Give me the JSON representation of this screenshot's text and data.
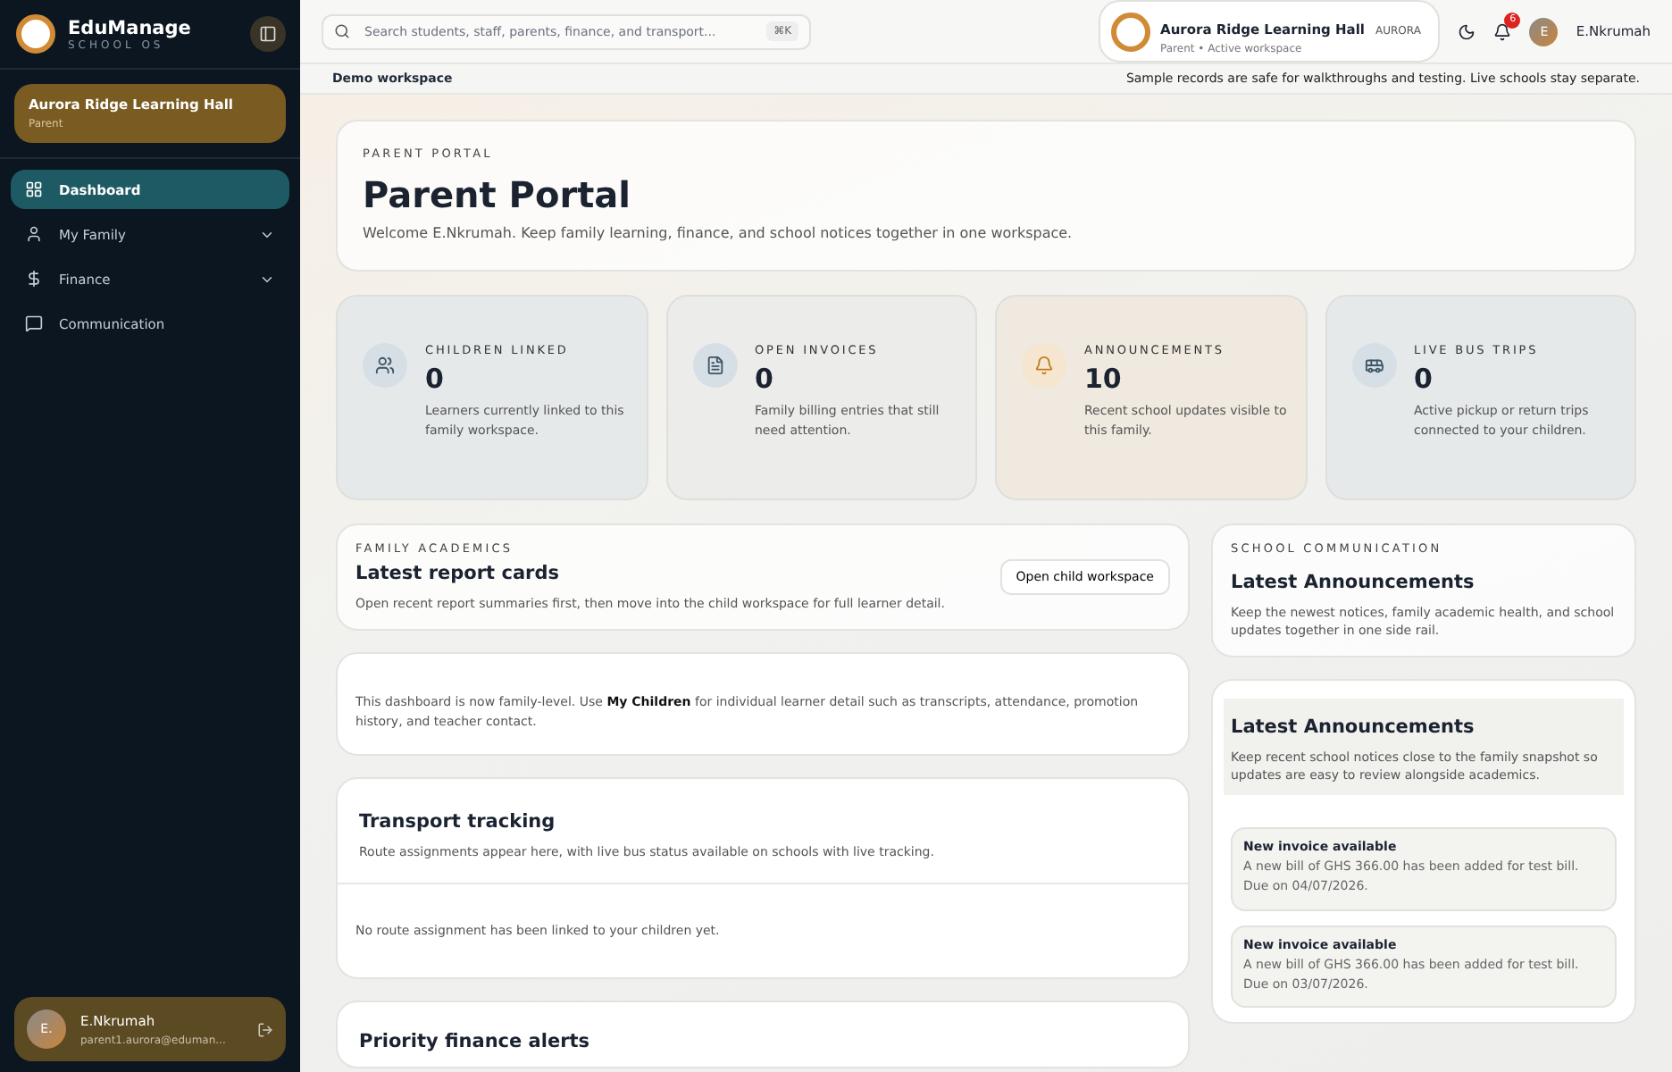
{
  "brand": {
    "name": "EduManage",
    "tagline": "SCHOOL OS"
  },
  "school_card": {
    "name": "Aurora Ridge Learning Hall",
    "role": "Parent"
  },
  "nav": [
    {
      "label": "Dashboard",
      "selected": true,
      "expandable": false
    },
    {
      "label": "My Family",
      "selected": false,
      "expandable": true
    },
    {
      "label": "Finance",
      "selected": false,
      "expandable": true
    },
    {
      "label": "Communication",
      "selected": false,
      "expandable": false
    }
  ],
  "user_card": {
    "initial": "E.",
    "name": "E.Nkrumah",
    "email": "parent1.aurora@eduman..."
  },
  "search": {
    "placeholder": "Search students, staff, parents, finance, and transport...",
    "shortcut": "⌘K"
  },
  "workspace": {
    "name": "Aurora Ridge Learning Hall",
    "code": "AURORA",
    "role": "Parent",
    "separator": "•",
    "status": "Active workspace"
  },
  "notifications": {
    "count": "6"
  },
  "account": {
    "initial": "E",
    "name": "E.Nkrumah"
  },
  "demo_bar": {
    "label": "Demo workspace",
    "note": "Sample records are safe for walkthroughs and testing. Live schools stay separate."
  },
  "hero": {
    "eyebrow": "PARENT PORTAL",
    "title": "Parent Portal",
    "subtitle": "Welcome E.Nkrumah. Keep family learning, finance, and school notices together in one workspace."
  },
  "stats": [
    {
      "label": "CHILDREN LINKED",
      "value": "0",
      "text": "Learners currently linked to this family workspace."
    },
    {
      "label": "OPEN INVOICES",
      "value": "0",
      "text": "Family billing entries that still need attention."
    },
    {
      "label": "ANNOUNCEMENTS",
      "value": "10",
      "text": "Recent school updates visible to this family."
    },
    {
      "label": "LIVE BUS TRIPS",
      "value": "0",
      "text": "Active pickup or return trips connected to your children."
    }
  ],
  "academics": {
    "eyebrow": "FAMILY ACADEMICS",
    "title": "Latest report cards",
    "text": "Open recent report summaries first, then move into the child workspace for full learner detail.",
    "button": "Open child workspace"
  },
  "notice": {
    "text": "This dashboard is now family-level. Use **My Children** for individual learner detail such as transcripts, attendance, promotion history, and teacher contact."
  },
  "transport": {
    "title": "Transport tracking",
    "text": "Route assignments appear here, with live bus status available on schools with live tracking.",
    "empty": "No route assignment has been linked to your children yet."
  },
  "finance_alerts": {
    "title": "Priority finance alerts"
  },
  "communication": {
    "eyebrow": "SCHOOL COMMUNICATION",
    "title": "Latest Announcements",
    "text": "Keep the newest notices, family academic health, and school updates together in one side rail."
  },
  "announcements": {
    "title": "Latest Announcements",
    "text": "Keep recent school notices close to the family snapshot so updates are easy to review alongside academics.",
    "items": [
      {
        "title": "New invoice available",
        "text": "A new bill of GHS 366.00 has been added for test bill. Due on 04/07/2026."
      },
      {
        "title": "New invoice available",
        "text": "A new bill of GHS 366.00 has been added for test bill. Due on 03/07/2026."
      }
    ]
  }
}
